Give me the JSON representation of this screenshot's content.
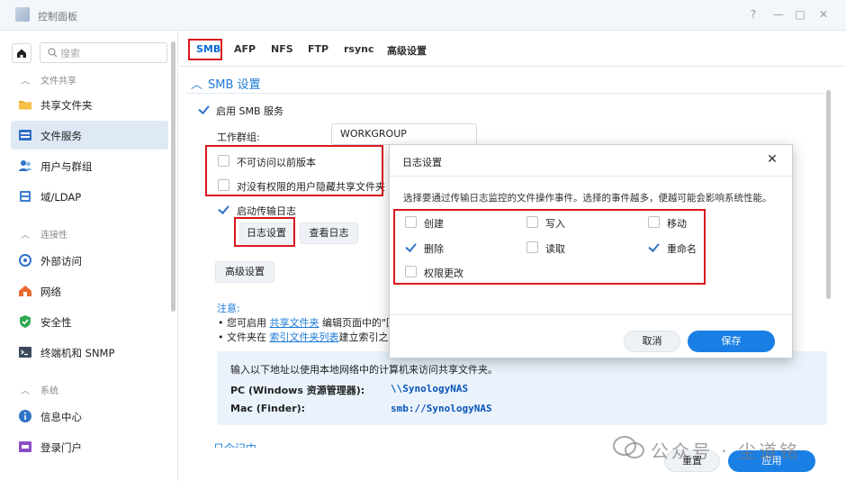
{
  "window": {
    "title": "控制面板",
    "controls": [
      "?",
      "—",
      "□",
      "✕"
    ]
  },
  "sidebar": {
    "search_placeholder": "搜索",
    "groups": {
      "file_sharing": "文件共享",
      "connectivity": "连接性",
      "system": "系统"
    },
    "items": {
      "shared_folder": "共享文件夹",
      "file_services": "文件服务",
      "user_group": "用户与群组",
      "domain_ldap": "域/LDAP",
      "external_access": "外部访问",
      "network": "网络",
      "security": "安全性",
      "terminal_snmp": "终端机和 SNMP",
      "info_center": "信息中心",
      "login_portal": "登录门户"
    }
  },
  "tabs": [
    "SMB",
    "AFP",
    "NFS",
    "FTP",
    "rsync",
    "高级设置"
  ],
  "smb": {
    "section_title": "SMB 设置",
    "enable_smb": "启用 SMB 服务",
    "enable_smb_checked": true,
    "workgroup_label": "工作群组:",
    "workgroup_value": "WORKGROUP",
    "hide_prev_versions": "不可访问以前版本",
    "hide_folders_no_perm": "对没有权限的用户隐藏共享文件夹",
    "enable_transfer_log": "启动传输日志",
    "enable_transfer_log_checked": true,
    "log_settings_btn": "日志设置",
    "view_logs_btn": "查看日志",
    "advanced_btn": "高级设置",
    "notes_head": "注意:",
    "note1_prefix": "您可启用",
    "note1_link": "共享文件夹",
    "note1_suffix": "编辑页面中的\"回",
    "note2_prefix": "文件夹在",
    "note2_link": "索引文件夹列表",
    "note2_suffix": "建立索引之后",
    "info_line": "输入以下地址以使用本地网络中的计算机来访问共享文件夹。",
    "pc_label": "PC (Windows 资源管理器):",
    "pc_value": "\\\\SynologyNAS",
    "mac_label": "Mac (Finder):",
    "mac_value": "smb://SynologyNAS",
    "cutoff_text": "日今记中",
    "reset_btn": "重置",
    "apply_btn": "应用"
  },
  "dialog": {
    "title": "日志设置",
    "description": "选择要通过传输日志监控的文件操作事件。选择的事件越多，便越可能会影响系统性能。",
    "options": {
      "create": {
        "label": "创建",
        "checked": false
      },
      "write": {
        "label": "写入",
        "checked": false
      },
      "move": {
        "label": "移动",
        "checked": false
      },
      "delete": {
        "label": "删除",
        "checked": true
      },
      "read": {
        "label": "读取",
        "checked": false
      },
      "rename": {
        "label": "重命名",
        "checked": true
      },
      "perm_change": {
        "label": "权限更改",
        "checked": false
      }
    },
    "cancel_btn": "取消",
    "save_btn": "保存"
  },
  "watermark": {
    "text": "公众号 · 尘道铭"
  },
  "colors": {
    "accent": "#1a7fe5",
    "highlight_box": "#d9181e",
    "info_bg": "#eaf3fc"
  }
}
